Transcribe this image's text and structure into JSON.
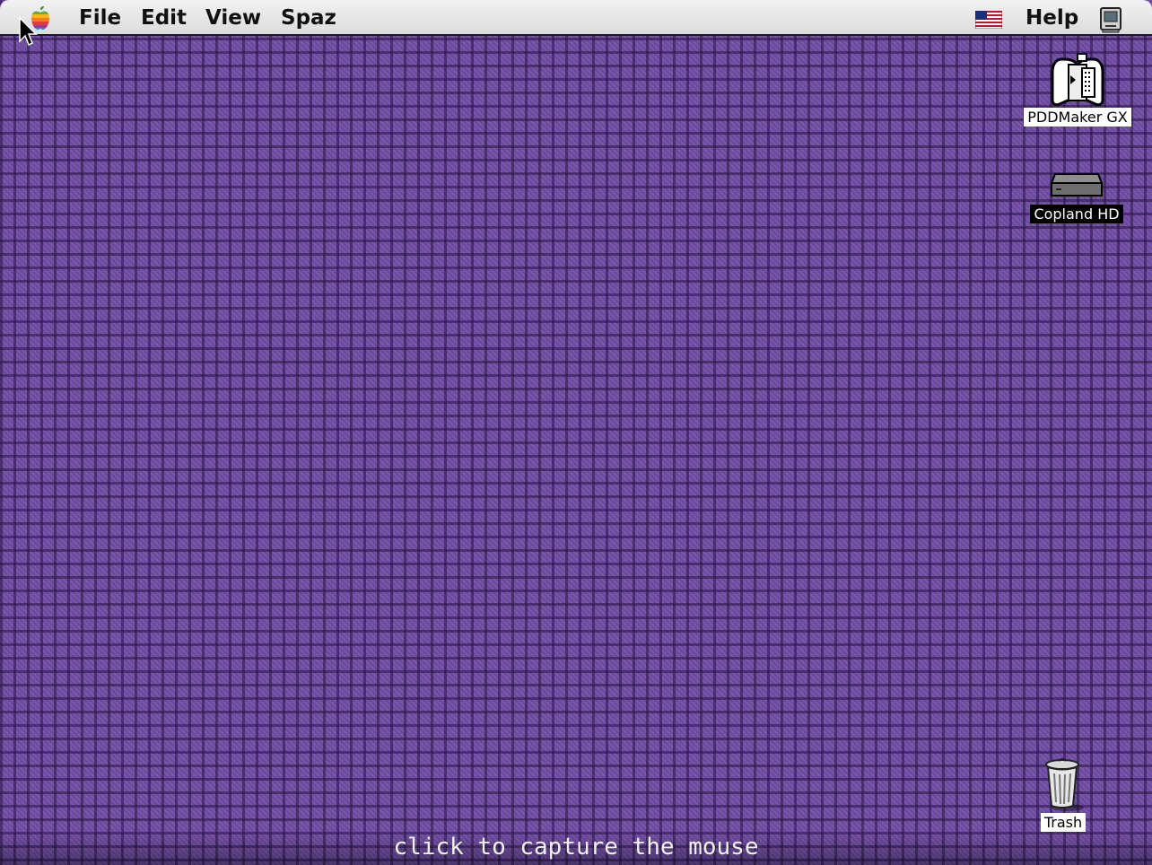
{
  "menubar": {
    "apple_icon": "apple-rainbow-icon",
    "items": [
      {
        "label": "File"
      },
      {
        "label": "Edit"
      },
      {
        "label": "View"
      },
      {
        "label": "Spaz"
      }
    ],
    "keyboard_icon": "us-flag-icon",
    "help_label": "Help",
    "app_switch_icon": "computer-icon"
  },
  "desktop": {
    "background_color": "#6a4a9a",
    "icons": [
      {
        "label": "PDDMaker GX",
        "icon": "pddmaker-app-icon",
        "selected": false
      },
      {
        "label": "Copland HD",
        "icon": "hard-drive-icon",
        "selected": true
      },
      {
        "label": "Trash",
        "icon": "trash-icon",
        "selected": false
      }
    ]
  },
  "overlay": {
    "hint": "click to capture the mouse"
  }
}
